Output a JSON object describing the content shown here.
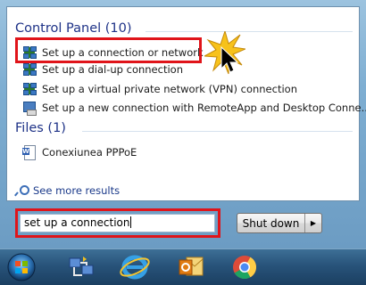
{
  "results": {
    "control_panel": {
      "header": "Control Panel (10)",
      "items": [
        "Set up a connection or network",
        "Set up a dial-up connection",
        "Set up a virtual private network (VPN) connection",
        "Set up a new connection with RemoteApp and Desktop Conne..."
      ]
    },
    "files": {
      "header": "Files (1)",
      "items": [
        "Conexiunea PPPoE"
      ]
    },
    "see_more": "See more results"
  },
  "search": {
    "value": "set up a connection"
  },
  "shutdown": {
    "label": "Shut down",
    "arrow": "▶"
  },
  "taskbar": {
    "items": [
      "start-orb-icon",
      "network-connections-icon",
      "internet-explorer-icon",
      "outlook-icon",
      "chrome-icon"
    ]
  },
  "colors": {
    "highlight_red": "#e0141a",
    "header_blue": "#1e3287",
    "burst_yellow": "#f7c21b"
  }
}
